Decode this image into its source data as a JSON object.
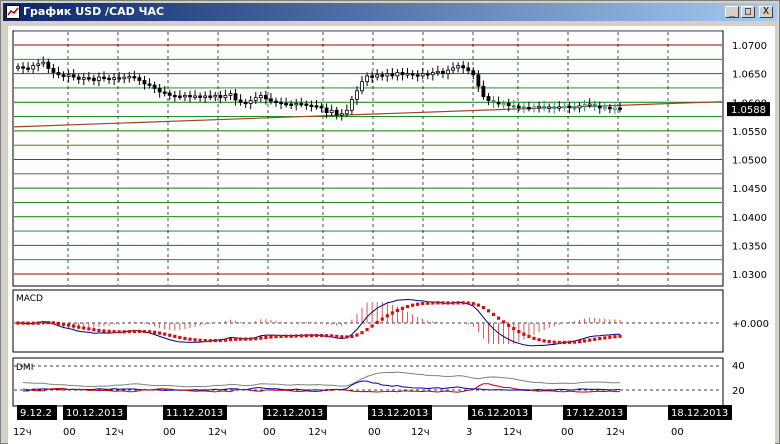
{
  "window": {
    "title": "График USD /CAD  ЧАС",
    "buttons": {
      "minimize": "_",
      "maximize": "□",
      "close": "X"
    }
  },
  "colors": {
    "candle": "#000000",
    "trend": "#a0442c",
    "grid_green": "#008000",
    "grid_red": "#a00000",
    "macd_line": "#000080",
    "macd_signal": "#d01010",
    "dmi_plus": "#0000c0",
    "dmi_minus": "#c00000",
    "adx": "#808080"
  },
  "price_panel": {
    "levels": [
      "1.0700",
      "1.0650",
      "1.0600",
      "1.0550",
      "1.0500",
      "1.0450",
      "1.0400",
      "1.0350",
      "1.0300"
    ],
    "current": "1.0588",
    "ylim": [
      1.028,
      1.072
    ]
  },
  "macd_panel": {
    "title": "MACD",
    "zero_label": "+0.000"
  },
  "dmi_panel": {
    "title": "DMI",
    "levels": [
      "40",
      "20"
    ]
  },
  "dates": [
    "9.12.2",
    "10.12.2013",
    "11.12.2013",
    "12.12.2013",
    "13.12.2013",
    "16.12.2013",
    "17.12.2013",
    "18.12.2013"
  ],
  "time_ticks": [
    "12ч",
    "00",
    "12ч",
    "00",
    "12ч",
    "00",
    "12ч",
    "00",
    "12ч",
    "3",
    "12ч",
    "00",
    "12ч",
    "00"
  ],
  "chart_data": {
    "type": "candlestick",
    "x_unit": "hour",
    "close": [
      1.0662,
      1.066,
      1.0658,
      1.0664,
      1.0667,
      1.067,
      1.0659,
      1.0652,
      1.0648,
      1.0645,
      1.0648,
      1.0644,
      1.064,
      1.0643,
      1.0642,
      1.0638,
      1.0644,
      1.0642,
      1.064,
      1.0643,
      1.0641,
      1.0644,
      1.0645,
      1.0643,
      1.0638,
      1.0632,
      1.063,
      1.0624,
      1.0618,
      1.0616,
      1.0612,
      1.0611,
      1.061,
      1.0612,
      1.061,
      1.0611,
      1.0609,
      1.0611,
      1.061,
      1.0612,
      1.0608,
      1.0612,
      1.0615,
      1.0604,
      1.06,
      1.0598,
      1.0603,
      1.0608,
      1.0612,
      1.0606,
      1.0602,
      1.06,
      1.0598,
      1.0597,
      1.0596,
      1.0598,
      1.0597,
      1.0595,
      1.0594,
      1.0593,
      1.059,
      1.0582,
      1.0586,
      1.0578,
      1.058,
      1.0586,
      1.0605,
      1.062,
      1.0636,
      1.0646,
      1.0644,
      1.0648,
      1.0646,
      1.065,
      1.0646,
      1.0652,
      1.0648,
      1.065,
      1.0648,
      1.0646,
      1.065,
      1.0648,
      1.0652,
      1.0654,
      1.065,
      1.0656,
      1.066,
      1.0664,
      1.066,
      1.0655,
      1.0648,
      1.0628,
      1.061,
      1.0603,
      1.06,
      1.0597,
      1.0598,
      1.0594,
      1.0593,
      1.0592,
      1.0591,
      1.059,
      1.0592,
      1.0593,
      1.059,
      1.0592,
      1.059,
      1.0592,
      1.0593,
      1.0591,
      1.059,
      1.0594,
      1.0596,
      1.0597,
      1.0593,
      1.059,
      1.0591,
      1.0589,
      1.059,
      1.0588
    ]
  }
}
